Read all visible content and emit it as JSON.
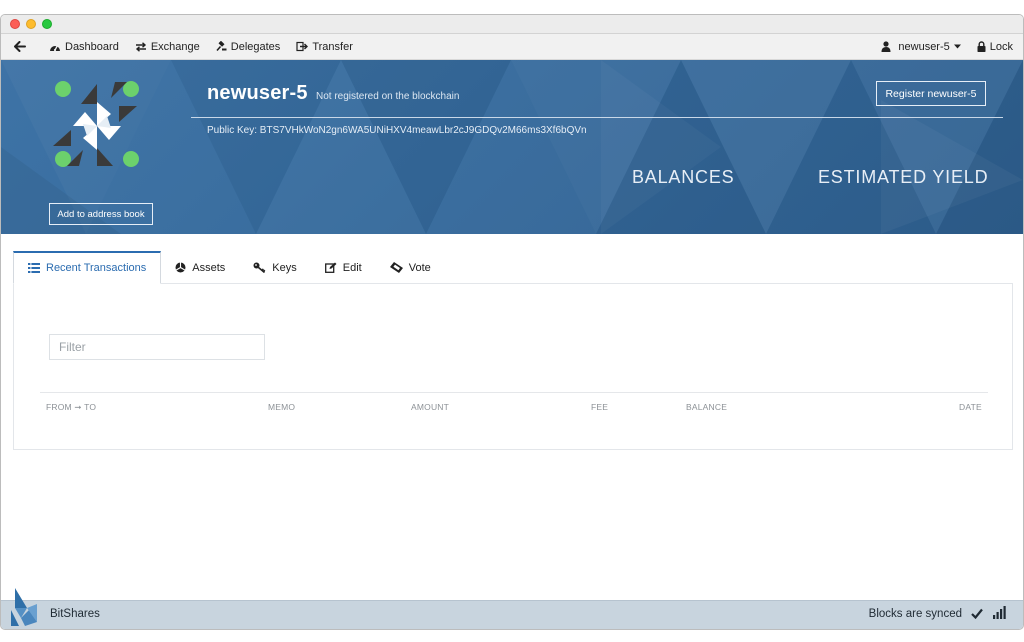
{
  "nav": {
    "back_icon": "arrow-left-icon",
    "items": [
      {
        "label": "Dashboard",
        "icon": "dashboard-icon"
      },
      {
        "label": "Exchange",
        "icon": "exchange-icon"
      },
      {
        "label": "Delegates",
        "icon": "gavel-icon"
      },
      {
        "label": "Transfer",
        "icon": "transfer-icon"
      }
    ],
    "user": {
      "label": "newuser-5",
      "icon": "user-icon",
      "caret": "caret-down-icon"
    },
    "lock": {
      "label": "Lock",
      "icon": "lock-icon"
    }
  },
  "account": {
    "name": "newuser-5",
    "status": "Not registered on the blockchain",
    "public_key": "Public Key: BTS7VHkWoN2gn6WA5UNiHXV4meawLbr2cJ9GDQv2M66ms3Xf6bQVn",
    "register_label": "Register newuser-5",
    "add_address_label": "Add to address book",
    "balances_label": "BALANCES",
    "yield_label": "ESTIMATED YIELD"
  },
  "tabs": [
    {
      "label": "Recent Transactions",
      "icon": "list-icon",
      "active": true
    },
    {
      "label": "Assets",
      "icon": "pie-chart-icon",
      "active": false
    },
    {
      "label": "Keys",
      "icon": "key-icon",
      "active": false
    },
    {
      "label": "Edit",
      "icon": "edit-icon",
      "active": false
    },
    {
      "label": "Vote",
      "icon": "ticket-icon",
      "active": false
    }
  ],
  "transactions": {
    "filter_placeholder": "Filter",
    "filter_value": "",
    "columns": [
      "FROM ➞ TO",
      "MEMO",
      "AMOUNT",
      "FEE",
      "BALANCE",
      "DATE"
    ]
  },
  "status_bar": {
    "app_name": "BitShares",
    "sync_text": "Blocks are synced",
    "sync_icon": "check-icon",
    "signal_icon": "signal-icon"
  },
  "colors": {
    "hero": "#356a9c",
    "accent": "#2b6cb0",
    "status_bar": "#c8d4de",
    "identicon_green": "#6cd16c",
    "identicon_dark": "#3a3a3a"
  }
}
